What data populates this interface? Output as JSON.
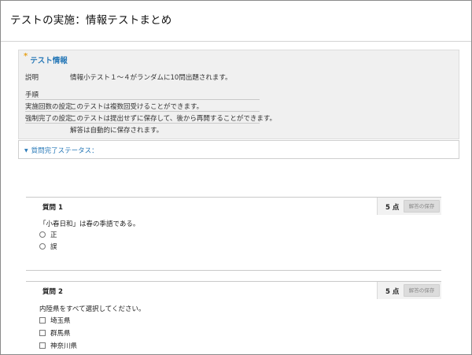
{
  "page": {
    "title": "テストの実施：情報テストまとめ"
  },
  "test_info": {
    "heading": "テスト情報",
    "rows": [
      {
        "label": "説明",
        "value": "情報小テスト１～４がランダムに10問出題されます。"
      },
      {
        "label": "手順",
        "value": ""
      },
      {
        "label": "実施回数の設定",
        "value": "このテストは複数回受けることができます。"
      },
      {
        "label": "強制完了の設定",
        "value": "このテストは提出せずに保存して、後から再開することができます。"
      },
      {
        "label": "",
        "value": "解答は自動的に保存されます。"
      }
    ]
  },
  "status": {
    "label": "質問完了ステータス："
  },
  "questions": [
    {
      "title": "質問 1",
      "points": "5 点",
      "save_label": "解答の保存",
      "text": "「小春日和」は春の季語である。",
      "options": [
        "正",
        "誤"
      ]
    },
    {
      "title": "質問 2",
      "points": "5 点",
      "save_label": "解答の保存",
      "text": "内陸県をすべて選択してください。",
      "options": [
        "埼玉県",
        "群馬県",
        "神奈川県"
      ]
    }
  ],
  "colors": {
    "link": "#2a7ab8",
    "star": "#e7a21b",
    "panel": "#f0f0f0"
  }
}
